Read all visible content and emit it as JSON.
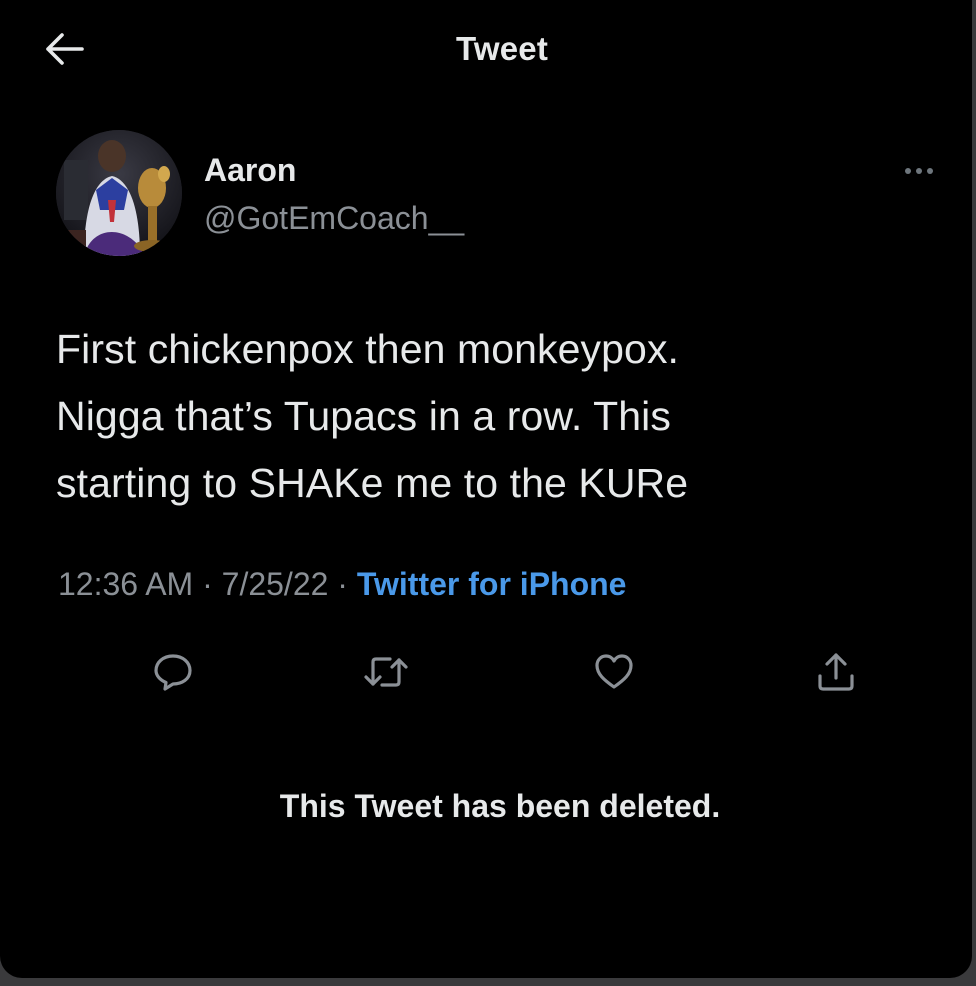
{
  "header": {
    "title": "Tweet",
    "back_icon": "arrow-left-icon"
  },
  "author": {
    "display_name": "Aaron",
    "handle": "@GotEmCoach__",
    "more_icon": "more-horizontal-icon"
  },
  "tweet": {
    "text": "First chickenpox then monkeypox.\nNigga that’s Tupacs in a row. This\nstarting to SHAKe me to the KURe",
    "time": "12:36 AM",
    "separator": " · ",
    "date": "7/25/22",
    "source": "Twitter for iPhone"
  },
  "actions": {
    "icons": [
      "reply-icon",
      "retweet-icon",
      "like-icon",
      "share-icon"
    ]
  },
  "notice": {
    "deleted": "This Tweet has been deleted."
  },
  "colors": {
    "background": "#000000",
    "text_primary": "#e7e9ea",
    "text_secondary": "#8b9096",
    "link": "#4a99e9",
    "icon": "#8b9096"
  }
}
